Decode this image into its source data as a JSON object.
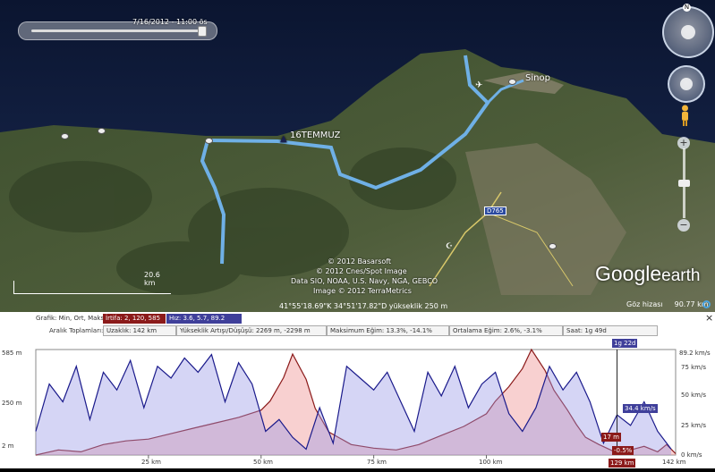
{
  "time_slider": {
    "label": "7/16/2012 - 11:00 ös"
  },
  "map_labels": {
    "waypoint": "16TEMMUZ",
    "city": "Sinop",
    "road": "D765",
    "scale": "20.6 km",
    "attribution": [
      "© 2012 Basarsoft",
      "© 2012 Cnes/Spot Image",
      "Data SIO, NOAA, U.S. Navy, NGA, GEBCO",
      "Image © 2012 TerraMetrics"
    ],
    "status": "41°55'18.69\"K   34°51'17.82\"D  yükseklik   250 m",
    "eye_alt_label": "Göz hizası",
    "eye_alt_value": "90.77 km",
    "logo_google": "Google",
    "logo_earth": "earth",
    "compass_n": "N"
  },
  "profile_header": {
    "graph_label": "Grafik: Min, Ort, Maks:",
    "elevation_box": "İrtifa: 2, 120, 585 m",
    "speed_box": "Hız: 3.6, 5.7, 89.2 km/s",
    "range_label": "Aralık Toplamları:",
    "cells": [
      "Uzaklık: 142 km",
      "Yükseklik Artışı/Düşüşü: 2269 m, -2298 m",
      "Maksimum Eğim: 13.3%, -14.1%",
      "Ortalama Eğim: 2.6%, -3.1%",
      "Saat: 1g 49d"
    ],
    "close": "×"
  },
  "chart_data": {
    "type": "area",
    "x_unit": "km",
    "xlim": [
      0,
      142
    ],
    "x_ticks": [
      "25 km",
      "50 km",
      "75 km",
      "100 km",
      "142 km"
    ],
    "y_left_ticks": [
      "585 m",
      "250 m",
      "2 m"
    ],
    "y_right_ticks": [
      "89.2 km/s",
      "75 km/s",
      "50 km/s",
      "25 km/s",
      "0 km/s"
    ],
    "cursor": {
      "x": 129,
      "x_label": "129 km",
      "top_label": "1g 22d",
      "speed": "34.4 km/s",
      "elevation": "17 m",
      "slope": "-0.5%"
    },
    "series": [
      {
        "name": "İrtifa",
        "unit": "m",
        "color": "#8b1a1a",
        "x": [
          0,
          5,
          10,
          15,
          20,
          25,
          30,
          35,
          40,
          45,
          50,
          52,
          55,
          57,
          60,
          62,
          65,
          70,
          75,
          80,
          85,
          90,
          95,
          100,
          102,
          105,
          108,
          110,
          113,
          115,
          118,
          120,
          122,
          125,
          128,
          129,
          132,
          135,
          138,
          140,
          142
        ],
        "values": [
          2,
          30,
          20,
          60,
          80,
          90,
          120,
          150,
          180,
          210,
          250,
          300,
          430,
          560,
          420,
          260,
          130,
          60,
          40,
          30,
          60,
          110,
          160,
          230,
          300,
          380,
          480,
          585,
          470,
          360,
          250,
          170,
          100,
          60,
          25,
          17,
          30,
          50,
          20,
          60,
          10
        ]
      },
      {
        "name": "Hız",
        "unit": "km/s",
        "color": "#1a1a8b",
        "x": [
          0,
          3,
          6,
          9,
          12,
          15,
          18,
          21,
          24,
          27,
          30,
          33,
          36,
          39,
          42,
          45,
          48,
          51,
          54,
          57,
          60,
          63,
          66,
          69,
          72,
          75,
          78,
          81,
          84,
          87,
          90,
          93,
          96,
          99,
          102,
          105,
          108,
          111,
          114,
          117,
          120,
          123,
          126,
          129,
          132,
          135,
          138,
          141
        ],
        "values": [
          20,
          60,
          45,
          75,
          30,
          70,
          55,
          80,
          40,
          75,
          65,
          82,
          70,
          85,
          45,
          78,
          60,
          20,
          30,
          15,
          5,
          40,
          10,
          75,
          65,
          55,
          70,
          45,
          20,
          70,
          50,
          75,
          40,
          60,
          70,
          35,
          20,
          40,
          75,
          55,
          70,
          45,
          10,
          34,
          25,
          45,
          20,
          5
        ]
      }
    ]
  }
}
